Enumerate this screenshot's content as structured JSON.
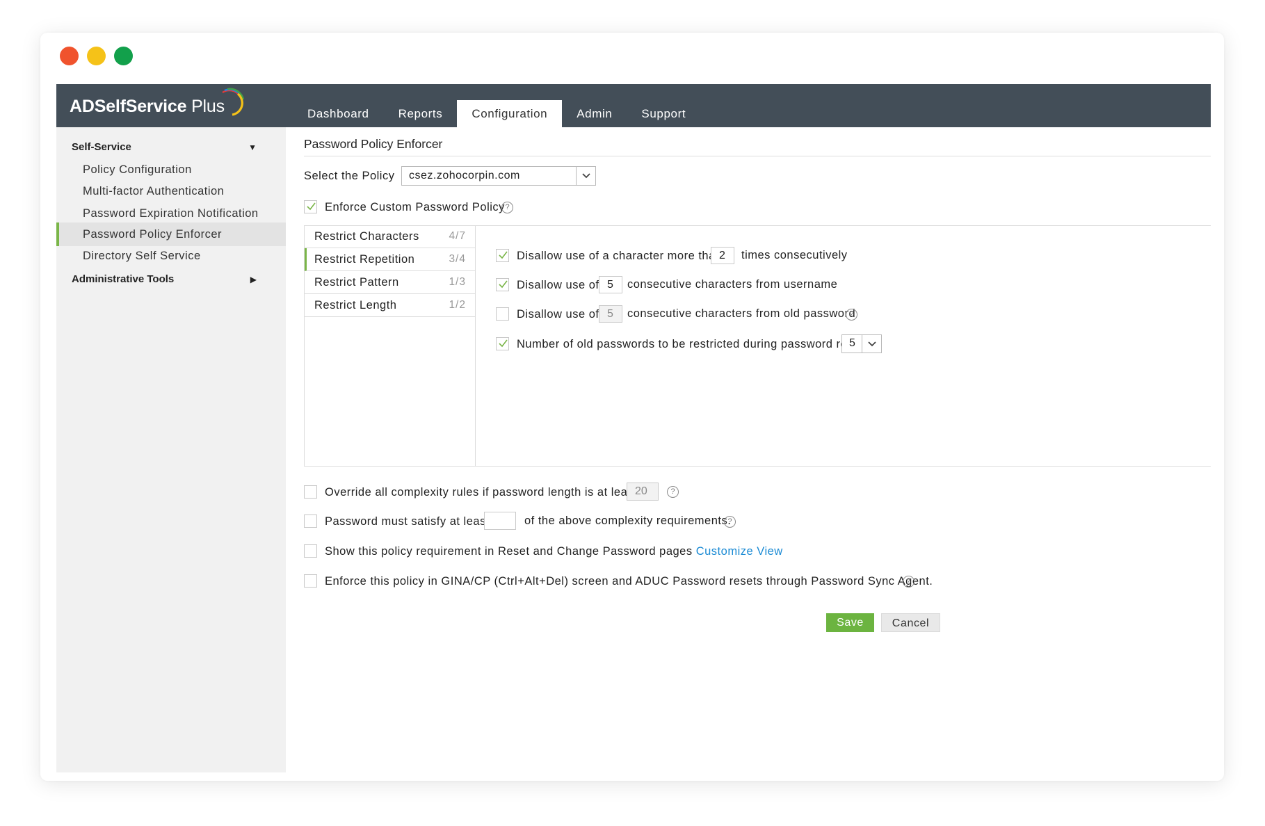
{
  "app": {
    "logo_main": "ADSelfService",
    "logo_plus": "Plus"
  },
  "nav": {
    "tabs": [
      {
        "label": "Dashboard"
      },
      {
        "label": "Reports"
      },
      {
        "label": "Configuration"
      },
      {
        "label": "Admin"
      },
      {
        "label": "Support"
      }
    ],
    "active_tab": "Configuration"
  },
  "sidebar": {
    "group1": "Self-Service",
    "items": [
      {
        "label": "Policy Configuration"
      },
      {
        "label": "Multi-factor Authentication"
      },
      {
        "label": "Password Expiration Notification"
      },
      {
        "label": "Password Policy Enforcer"
      },
      {
        "label": "Directory Self Service"
      }
    ],
    "active_item": "Password Policy Enforcer",
    "group2": "Administrative Tools"
  },
  "page": {
    "title": "Password Policy Enforcer",
    "select_policy_label": "Select the Policy",
    "select_policy_value": "csez.zohocorpin.com",
    "enforce_custom_label": "Enforce Custom Password Policy",
    "enforce_custom_checked": true
  },
  "rules": [
    {
      "label": "Restrict Characters",
      "count": "4/7"
    },
    {
      "label": "Restrict Repetition",
      "count": "3/4"
    },
    {
      "label": "Restrict Pattern",
      "count": "1/3"
    },
    {
      "label": "Restrict Length",
      "count": "1/2"
    }
  ],
  "active_rule": "Restrict Repetition",
  "repetition": {
    "opt1": {
      "checked": true,
      "before": "Disallow use of a character more than",
      "value": "2",
      "after": "times consecutively"
    },
    "opt2": {
      "checked": true,
      "before": "Disallow use of",
      "value": "5",
      "after": "consecutive characters from username"
    },
    "opt3": {
      "checked": false,
      "before": "Disallow use of",
      "value": "5",
      "after": "consecutive characters from old password"
    },
    "opt4": {
      "checked": true,
      "label": "Number of old passwords to be restricted during password reset",
      "value": "5"
    }
  },
  "bottom": {
    "override": {
      "checked": false,
      "label": "Override all complexity rules if password length is at least",
      "value": "20"
    },
    "satisfy": {
      "checked": false,
      "before": "Password must satisfy at least",
      "value": "",
      "after": "of the above complexity requirements."
    },
    "show": {
      "checked": false,
      "label": "Show this policy requirement in Reset and Change Password pages",
      "link": "Customize View"
    },
    "gina": {
      "checked": false,
      "label": "Enforce this policy in GINA/CP (Ctrl+Alt+Del) screen and ADUC Password resets through Password Sync Agent."
    }
  },
  "buttons": {
    "save": "Save",
    "cancel": "Cancel"
  },
  "colors": {
    "header": "#434e58",
    "accent": "#7ab548",
    "save": "#6cb440",
    "link": "#1a8ad4"
  }
}
